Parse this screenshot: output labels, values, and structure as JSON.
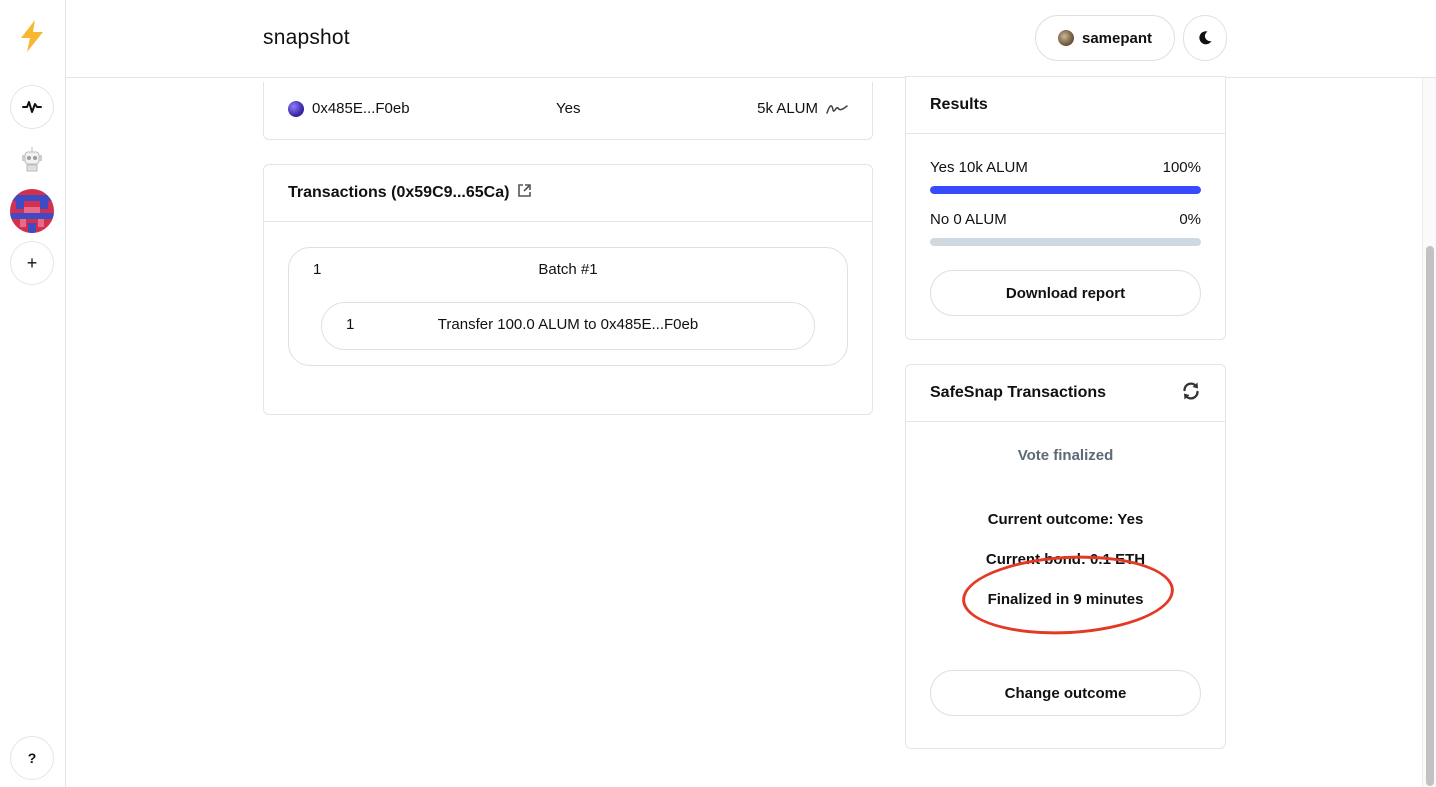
{
  "app": {
    "brand": "snapshot"
  },
  "header": {
    "username": "samepant"
  },
  "sidebar": {
    "help_label": "?",
    "add_label": "+"
  },
  "vote_row": {
    "address": "0x485E...F0eb",
    "choice": "Yes",
    "power": "5k ALUM"
  },
  "transactions": {
    "title": "Transactions (0x59C9...65Ca)",
    "batch": {
      "index": "1",
      "label": "Batch #1"
    },
    "items": [
      {
        "index": "1",
        "label": "Transfer 100.0 ALUM to 0x485E...F0eb"
      }
    ]
  },
  "results": {
    "title": "Results",
    "choices": [
      {
        "label": "Yes 10k ALUM",
        "percent_label": "100%",
        "fraction": 1.0
      },
      {
        "label": "No 0 ALUM",
        "percent_label": "0%",
        "fraction": 0.0
      }
    ],
    "download_label": "Download report"
  },
  "safesnap": {
    "title": "SafeSnap Transactions",
    "status": "Vote finalized",
    "current_outcome": "Current outcome: Yes",
    "current_bond": "Current bond: 0.1 ETH",
    "finalized": "Finalized in 9 minutes",
    "change_outcome_label": "Change outcome"
  },
  "colors": {
    "accent": "#384aff",
    "annotation": "#e23a24",
    "bar_track": "#d1d9e0"
  }
}
